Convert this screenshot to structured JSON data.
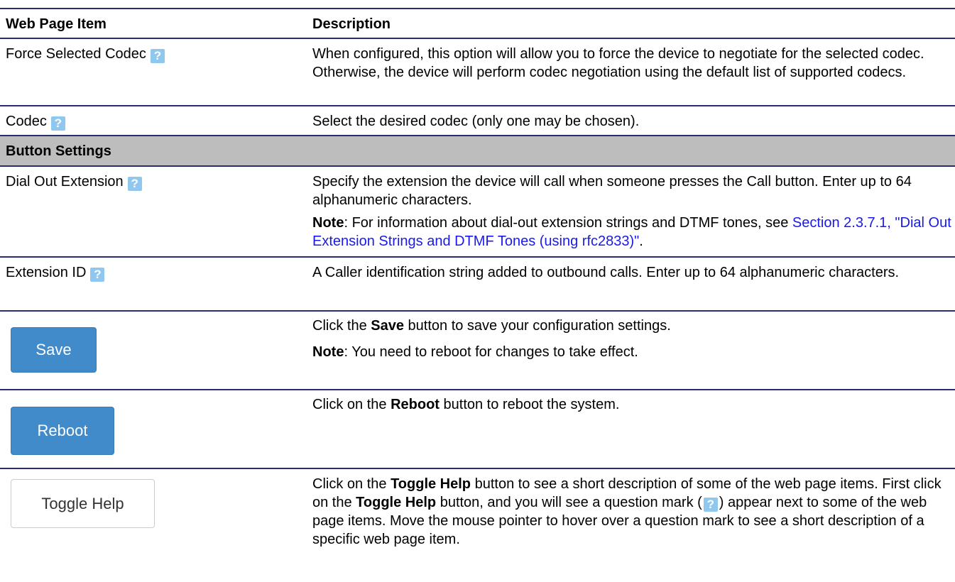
{
  "table": {
    "header": {
      "item": "Web Page Item",
      "description": "Description"
    },
    "rows": [
      {
        "item": "Force Selected Codec",
        "description": "When configured, this option will allow you to force the device to negotiate for the selected codec. Otherwise, the device will perform codec negotiation using the default list of supported codecs."
      },
      {
        "item": "Codec",
        "description": "Select the desired codec (only one may be chosen)."
      }
    ],
    "section": "Button Settings",
    "dial_out": {
      "item": "Dial Out Extension",
      "description": "Specify the extension the device will call when someone presses the Call button. Enter up to 64 alphanumeric characters.",
      "note_label": "Note",
      "note_text": ": For information about dial-out extension strings and DTMF tones, see ",
      "note_link": "Section 2.3.7.1, \"Dial Out Extension Strings and DTMF Tones (using rfc2833)\"",
      "note_end": "."
    },
    "extension_id": {
      "item": "Extension ID",
      "description": "A Caller identification string added to outbound calls. Enter up to 64 alphanumeric characters."
    },
    "save": {
      "button": "Save",
      "desc_pre": "Click the ",
      "desc_bold": "Save",
      "desc_post": " button to save your configuration settings.",
      "note_label": "Note",
      "note_text": ": You need to reboot for changes to take effect."
    },
    "reboot": {
      "button": "Reboot",
      "desc_pre": "Click on the ",
      "desc_bold": "Reboot",
      "desc_post": " button to reboot the system."
    },
    "toggle": {
      "button": "Toggle Help",
      "desc_1": "Click on the ",
      "desc_bold_1": "Toggle Help",
      "desc_2": " button to see a short description of some of the web page items. First click on the ",
      "desc_bold_2": "Toggle Help",
      "desc_3": " button, and you will see a question mark (",
      "desc_4": ") appear next to some of the web page items. Move the mouse pointer to hover over a question mark to see a short description of a specific web page item."
    },
    "help_icon_glyph": "?"
  },
  "colors": {
    "rule": "#2b2b70",
    "section_bg": "#bdbdbd",
    "primary_button": "#428bca",
    "help_icon": "#8fc7ee",
    "link": "#1a1ae6"
  }
}
